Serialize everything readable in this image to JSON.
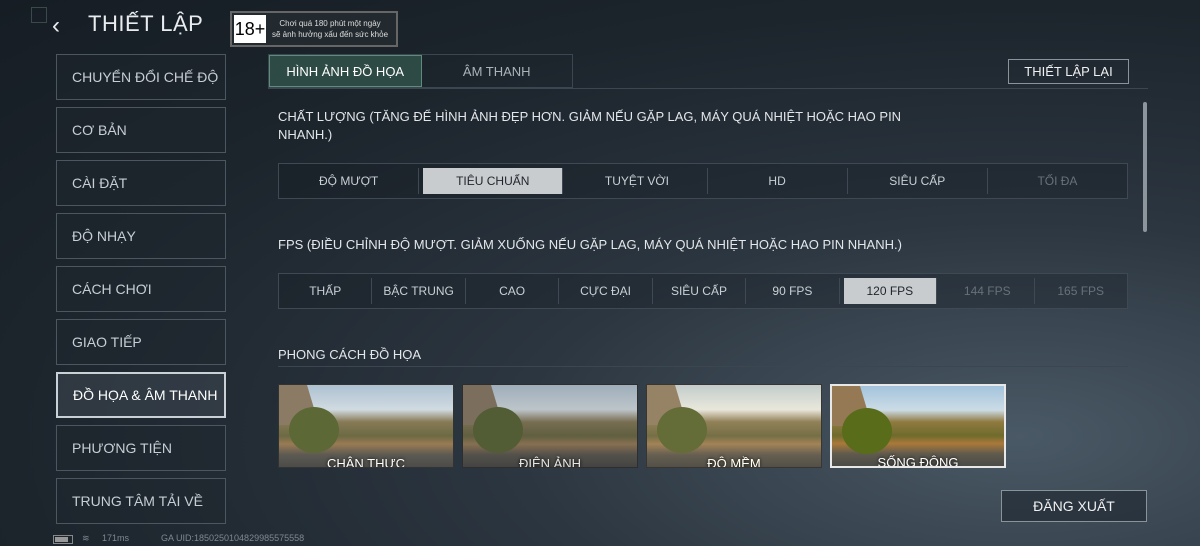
{
  "header": {
    "title": "THIẾT LẬP",
    "back_icon": "‹",
    "age_badge": "18+",
    "age_warning_line1": "Chơi quá 180 phút một ngày",
    "age_warning_line2": "sẽ ảnh hưởng xấu đến sức khỏe"
  },
  "sidebar": {
    "items": [
      {
        "label": "CHUYỂN ĐỔI CHẾ ĐỘ"
      },
      {
        "label": "CƠ BẢN"
      },
      {
        "label": "CÀI ĐẶT"
      },
      {
        "label": "ĐỘ NHẠY"
      },
      {
        "label": "CÁCH CHƠI"
      },
      {
        "label": "GIAO TIẾP"
      },
      {
        "label": "ĐỒ HỌA & ÂM THANH",
        "active": true
      },
      {
        "label": "PHƯƠNG TIỆN"
      },
      {
        "label": "TRUNG TÂM TẢI VỀ"
      }
    ]
  },
  "tabs": [
    {
      "label": "HÌNH ẢNH ĐỒ HỌA",
      "active": true
    },
    {
      "label": "ÂM THANH"
    }
  ],
  "reset_label": "THIẾT LẬP LẠI",
  "quality": {
    "heading": "CHẤT LƯỢNG (TĂNG ĐỂ HÌNH ẢNH ĐẸP HƠN. GIẢM NẾU GẶP LAG, MÁY QUÁ NHIỆT HOẶC HAO PIN NHANH.)",
    "options": [
      "ĐỘ MƯỢT",
      "TIÊU CHUẨN",
      "TUYỆT VỜI",
      "HD",
      "SIÊU CẤP",
      "TỐI ĐA"
    ],
    "selected": "TIÊU CHUẨN"
  },
  "fps": {
    "heading": "FPS (ĐIỀU CHỈNH ĐỘ MƯỢT. GIẢM XUỐNG NẾU GẶP LAG, MÁY QUÁ NHIỆT HOẶC HAO PIN NHANH.)",
    "options": [
      "THẤP",
      "BẬC TRUNG",
      "CAO",
      "CỰC ĐẠI",
      "SIÊU CẤP",
      "90 FPS",
      "120 FPS",
      "144 FPS",
      "165 FPS"
    ],
    "selected": "120 FPS"
  },
  "style": {
    "heading": "PHONG CÁCH ĐỒ HỌA",
    "options": [
      "CHÂN THỰC",
      "ĐIỆN ẢNH",
      "ĐỘ MỀM",
      "SỐNG ĐỘNG"
    ],
    "selected": "SỐNG ĐỘNG"
  },
  "logout_label": "ĐĂNG XUẤT",
  "status": {
    "ping": "171ms",
    "uid": "GA UID:1850250104829985575558"
  }
}
